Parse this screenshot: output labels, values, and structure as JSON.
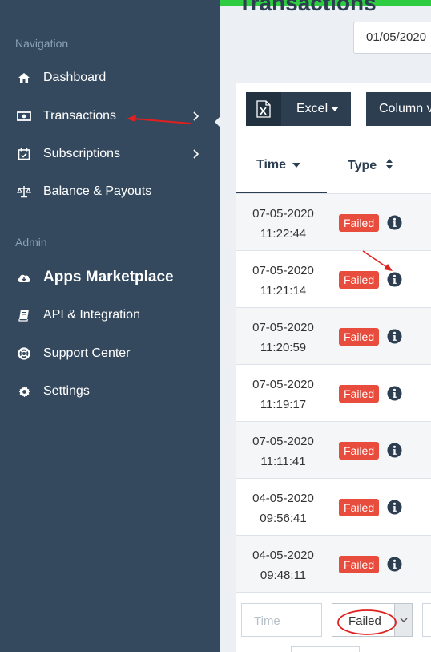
{
  "page": {
    "title": "Transactions",
    "date_range_value": "01/05/2020"
  },
  "sidebar": {
    "nav_heading": "Navigation",
    "admin_heading": "Admin",
    "nav_items": [
      {
        "label": "Dashboard",
        "icon": "home-icon"
      },
      {
        "label": "Transactions",
        "icon": "money-icon",
        "has_submenu": true,
        "active": true
      },
      {
        "label": "Subscriptions",
        "icon": "calendar-check-icon",
        "has_submenu": true
      },
      {
        "label": "Balance & Payouts",
        "icon": "balance-scale-icon"
      }
    ],
    "admin_items": [
      {
        "label": "Apps Marketplace",
        "icon": "cloud-download-icon"
      },
      {
        "label": "API & Integration",
        "icon": "book-icon"
      },
      {
        "label": "Support Center",
        "icon": "life-ring-icon"
      },
      {
        "label": "Settings",
        "icon": "gear-icon"
      }
    ]
  },
  "toolbar": {
    "excel_label": "Excel",
    "column_label": "Column v"
  },
  "table": {
    "headers": {
      "time": "Time",
      "type": "Type"
    },
    "rows": [
      {
        "date": "07-05-2020",
        "time": "11:22:44",
        "status": "Failed"
      },
      {
        "date": "07-05-2020",
        "time": "11:21:14",
        "status": "Failed"
      },
      {
        "date": "07-05-2020",
        "time": "11:20:59",
        "status": "Failed"
      },
      {
        "date": "07-05-2020",
        "time": "11:19:17",
        "status": "Failed"
      },
      {
        "date": "07-05-2020",
        "time": "11:11:41",
        "status": "Failed"
      },
      {
        "date": "04-05-2020",
        "time": "09:56:41",
        "status": "Failed"
      },
      {
        "date": "04-05-2020",
        "time": "09:48:11",
        "status": "Failed"
      }
    ]
  },
  "filters": {
    "time_placeholder": "Time",
    "type_selected": "Failed"
  },
  "colors": {
    "sidebar_bg": "#34495e",
    "failed_badge": "#e74c3c",
    "annotation_red": "#e0201f",
    "accent_green": "#2ecc40"
  }
}
